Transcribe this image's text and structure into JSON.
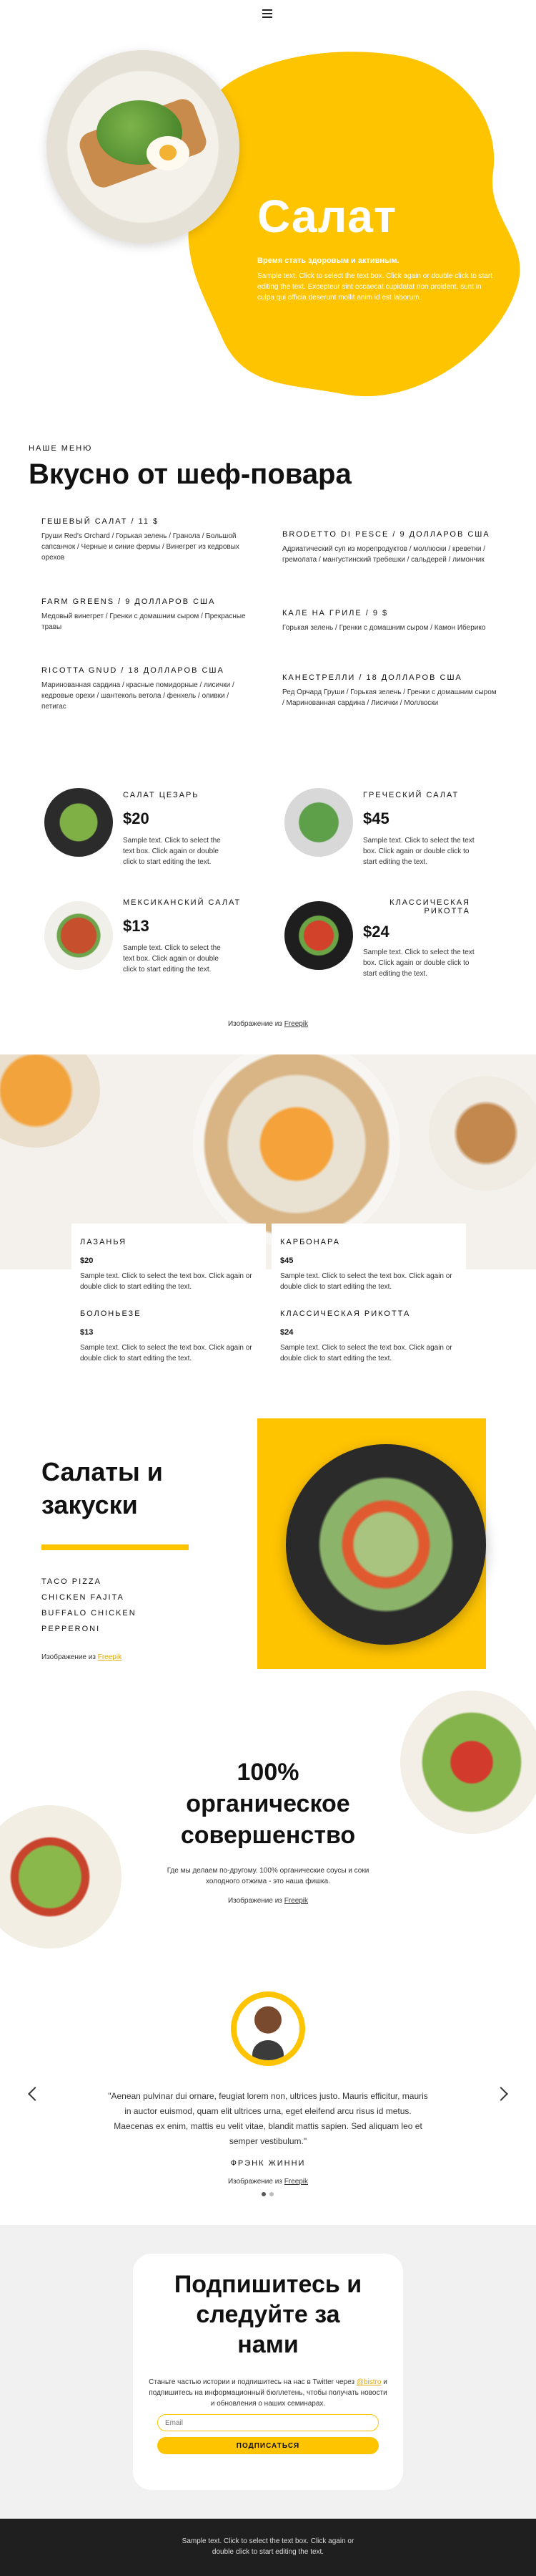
{
  "header": {
    "menu_icon": "hamburger-icon"
  },
  "hero": {
    "title": "Салат",
    "subtitle": "Время стать здоровым и активным.",
    "body": "Sample text. Click to select the text box. Click again or double click to start editing the text. Excepteur sint occaecat cupidatat non proident, sunt in culpa qui officia deserunt mollit anim id est laborum."
  },
  "menu": {
    "kicker": "Наше меню",
    "title": "Вкусно от шеф-повара",
    "items": [
      {
        "title": "Гешевый салат / 11 $",
        "desc": "Груши Red's Orchard / Горькая зелень / Гранола / Большой сапсанчок / Черные и синие фермы / Винегрет из кедровых орехов"
      },
      {
        "title": "Brodetto di Pesce / 9 долларов США",
        "desc": "Адриатический суп из морепродуктов / моллюски / креветки / гремолата / мангустинский требешки / сальдерей / лимончик"
      },
      {
        "title": "Farm Greens / 9 долларов США",
        "desc": "Медовый винегрет / Гренки с домашним сыром / Прекрасные травы"
      },
      {
        "title": "Кале на гриле / 9 $",
        "desc": "Горькая зелень / Гренки с домашним сыром / Камон Иберико"
      },
      {
        "title": "Ricotta Gnud / 18 долларов США",
        "desc": "Маринованная сардина / красные помидорные / лисички / кедровые орехи / шантеколь ветола / фенхель / оливки / петигас"
      },
      {
        "title": "Канестрелли / 18 долларов США",
        "desc": "Ред Орчард Груши / Горькая зелень / Гренки с домашним сыром / Маринованная сардина / Лисички / Моллюски"
      }
    ]
  },
  "dishes": [
    {
      "name": "Салат Цезарь",
      "price": "$20",
      "desc": "Sample text. Click to select the text box. Click again or double click to start editing the text."
    },
    {
      "name": "Греческий салат",
      "price": "$45",
      "desc": "Sample text. Click to select the text box. Click again or double click to start editing the text."
    },
    {
      "name": "Мексиканский салат",
      "price": "$13",
      "desc": "Sample text. Click to select the text box. Click again or double click to start editing the text."
    },
    {
      "name": "Классическая рикотта",
      "price": "$24",
      "desc": "Sample text. Click to select the text box. Click again or double click to start editing the text."
    }
  ],
  "credit_prefix": "Изображение из",
  "credit_link": "Freepik",
  "cards": [
    {
      "name": "Лазанья",
      "price": "$20",
      "desc": "Sample text. Click to select the text box. Click again or double click to start editing the text."
    },
    {
      "name": "Карбонара",
      "price": "$45",
      "desc": "Sample text. Click to select the text box. Click again or double click to start editing the text."
    },
    {
      "name": "Болоньезе",
      "price": "$13",
      "desc": "Sample text. Click to select the text box. Click again or double click to start editing the text."
    },
    {
      "name": "Классическая рикотта",
      "price": "$24",
      "desc": "Sample text. Click to select the text box. Click again or double click to start editing the text."
    }
  ],
  "snacks": {
    "title_line1": "Салаты и",
    "title_line2": "закуски",
    "items": [
      "Taco Pizza",
      "Chicken Fajita",
      "Buffalo Chicken",
      "Pepperoni"
    ]
  },
  "organic": {
    "line1": "100%",
    "line2": "органическое",
    "line3": "совершенство",
    "text": "Где мы делаем по-другому. 100% органические соусы и соки холодного отжима - это наша фишка."
  },
  "testimonial": {
    "quote": "\"Aenean pulvinar dui ornare, feugiat lorem non, ultrices justo. Mauris efficitur, mauris in auctor euismod, quam elit ultrices urna, eget eleifend arcu risus id metus. Maecenas ex enim, mattis eu velit vitae, blandit mattis sapien. Sed aliquam leo et semper vestibulum.\"",
    "author": "Фрэнк Жинни",
    "prev_icon": "chevron-left-icon",
    "next_icon": "chevron-right-icon"
  },
  "subscribe": {
    "line1": "Подпишитесь и",
    "line2": "следуйте за",
    "line3": "нами",
    "text_before": "Станьте частью истории и подпишитесь на нас в Twitter через",
    "text_link": "@bistro",
    "text_after": "и подпишитесь на информационный бюллетень, чтобы получать новости и обновления о наших семинарах.",
    "email_placeholder": "Email",
    "button": "Подписаться"
  },
  "footer": {
    "text": "Sample text. Click to select the text box. Click again or double click to start editing the text."
  },
  "colors": {
    "accent": "#ffc400",
    "dark": "#1f1f1f"
  }
}
